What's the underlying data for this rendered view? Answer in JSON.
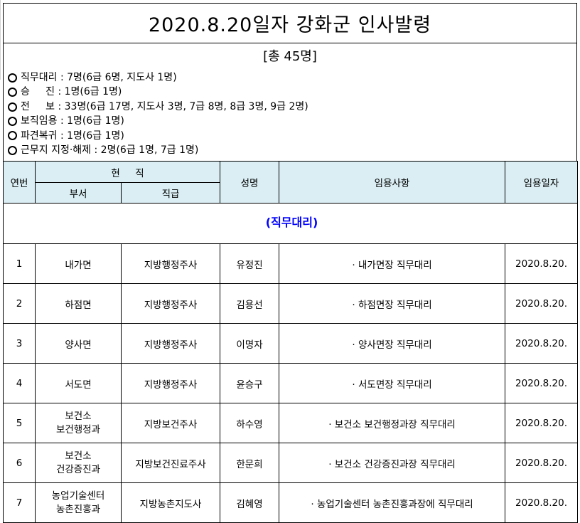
{
  "title": "2020.8.20일자 강화군 인사발령",
  "subtitle": "[총 45명]",
  "summary": [
    "직무대리 : 7명(6급 6명, 지도사 1명)",
    "승     진 : 1명(6급 1명)",
    "전     보 : 33명(6급 17명, 지도사 3명, 7급 8명, 8급 3명, 9급 2명)",
    "보직임용 : 1명(6급 1명)",
    "파견복귀 : 1명(6급 1명)",
    "근무지 지정·해제 : 2명(6급 1명, 7급 1명)"
  ],
  "table": {
    "headers": {
      "no": "연번",
      "current": "현     직",
      "dept": "부서",
      "rank": "직급",
      "name": "성명",
      "task": "임용사항",
      "date": "임용일자"
    },
    "section": "(직무대리)",
    "rows": [
      {
        "no": "1",
        "dept1": "내가면",
        "dept2": "",
        "rank": "지방행정주사",
        "name": "유정진",
        "task": "· 내가면장 직무대리",
        "date": "2020.8.20."
      },
      {
        "no": "2",
        "dept1": "하점면",
        "dept2": "",
        "rank": "지방행정주사",
        "name": "김용선",
        "task": "· 하점면장 직무대리",
        "date": "2020.8.20."
      },
      {
        "no": "3",
        "dept1": "양사면",
        "dept2": "",
        "rank": "지방행정주사",
        "name": "이명자",
        "task": "· 양사면장 직무대리",
        "date": "2020.8.20."
      },
      {
        "no": "4",
        "dept1": "서도면",
        "dept2": "",
        "rank": "지방행정주사",
        "name": "윤승구",
        "task": "· 서도면장 직무대리",
        "date": "2020.8.20."
      },
      {
        "no": "5",
        "dept1": "보건소",
        "dept2": "보건행정과",
        "rank": "지방보건주사",
        "name": "하수영",
        "task": "· 보건소 보건행정과장 직무대리",
        "date": "2020.8.20."
      },
      {
        "no": "6",
        "dept1": "보건소",
        "dept2": "건강증진과",
        "rank": "지방보건진료주사",
        "name": "한문희",
        "task": "· 보건소 건강증진과장 직무대리",
        "date": "2020.8.20."
      },
      {
        "no": "7",
        "dept1": "농업기술센터",
        "dept2": "농촌진흥과",
        "rank": "지방농촌지도사",
        "name": "김혜영",
        "task": "· 농업기술센터 농촌진흥과장에 직무대리",
        "date": "2020.8.20."
      }
    ]
  }
}
